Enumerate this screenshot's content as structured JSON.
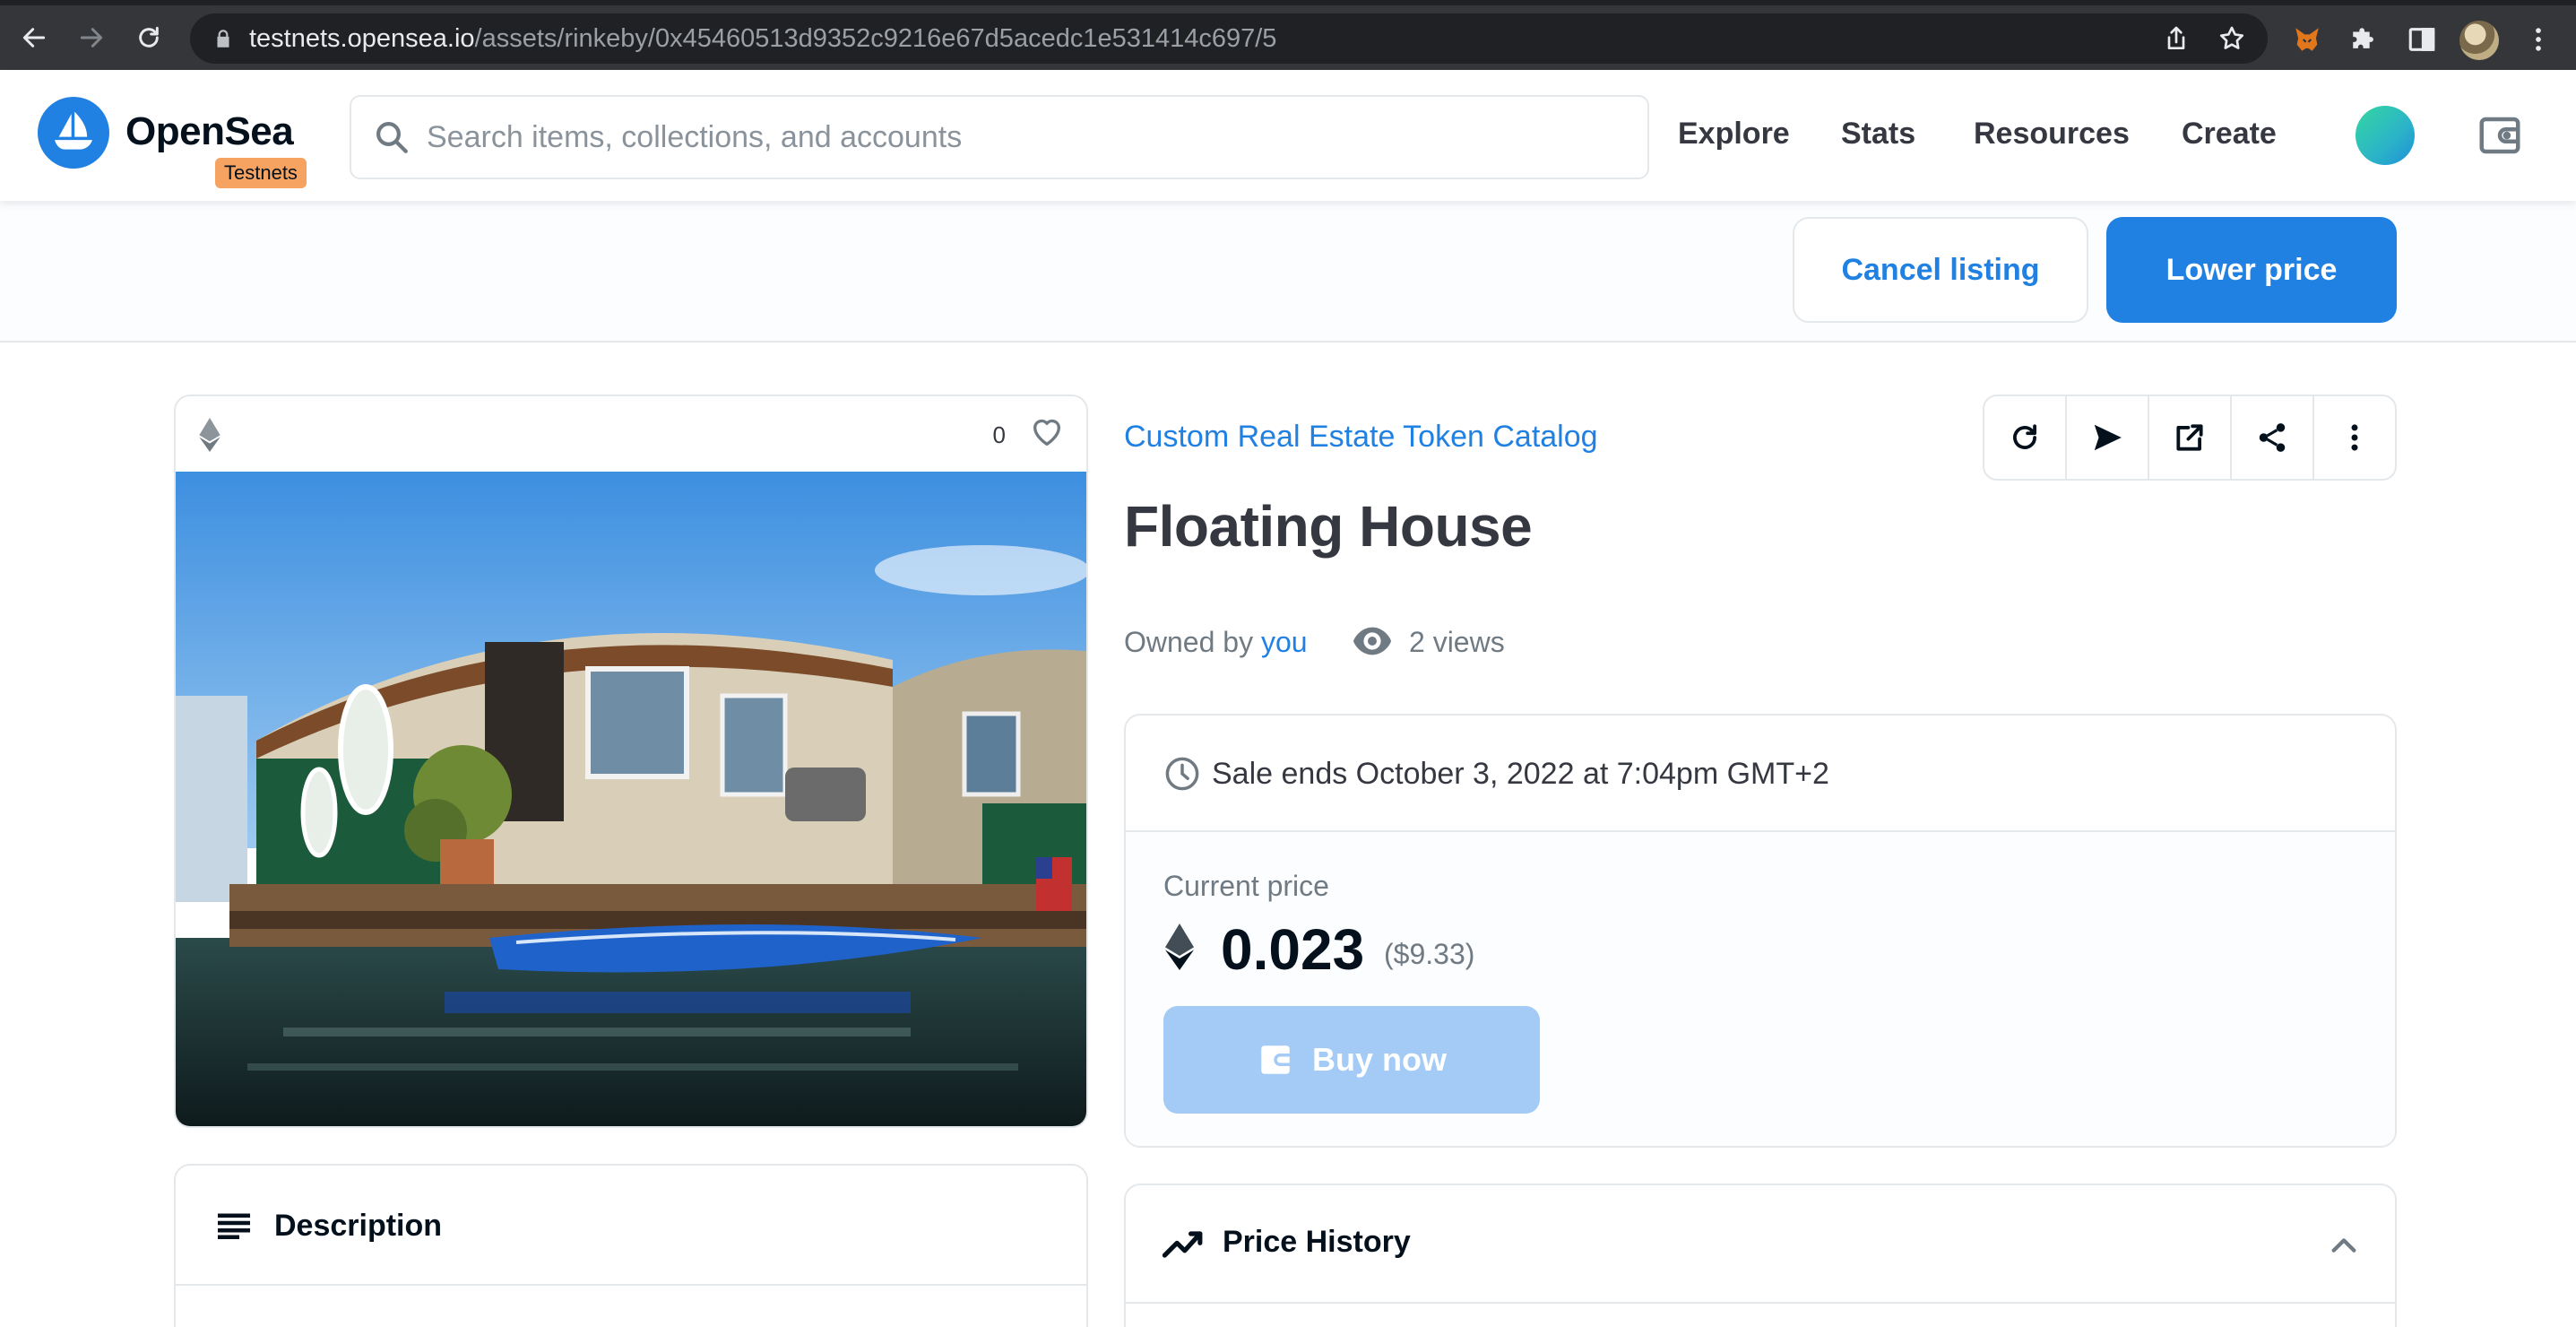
{
  "browser": {
    "url_host": "testnets.opensea.io",
    "url_path": "/assets/rinkeby/0x45460513d9352c9216e67d5acedc1e531414c697/5"
  },
  "header": {
    "logo_text": "OpenSea",
    "badge": "Testnets",
    "search_placeholder": "Search items, collections, and accounts",
    "nav": [
      "Explore",
      "Stats",
      "Resources",
      "Create"
    ]
  },
  "owner_actions": {
    "cancel_label": "Cancel listing",
    "lower_label": "Lower price"
  },
  "asset": {
    "favorites": "0",
    "collection": "Custom Real Estate Token Catalog",
    "title": "Floating House",
    "owned_by_label": "Owned by",
    "owner": "you",
    "views": "2 views"
  },
  "sale": {
    "ends_text": "Sale ends October 3, 2022 at 7:04pm GMT+2",
    "current_price_label": "Current price",
    "price": "0.023",
    "price_usd": "($9.33)",
    "buy_label": "Buy now"
  },
  "panels": {
    "description": "Description",
    "price_history": "Price History"
  },
  "colors": {
    "brand": "#2081e2",
    "badge": "#f6a361",
    "buy_disabled": "#a3cbf5"
  }
}
